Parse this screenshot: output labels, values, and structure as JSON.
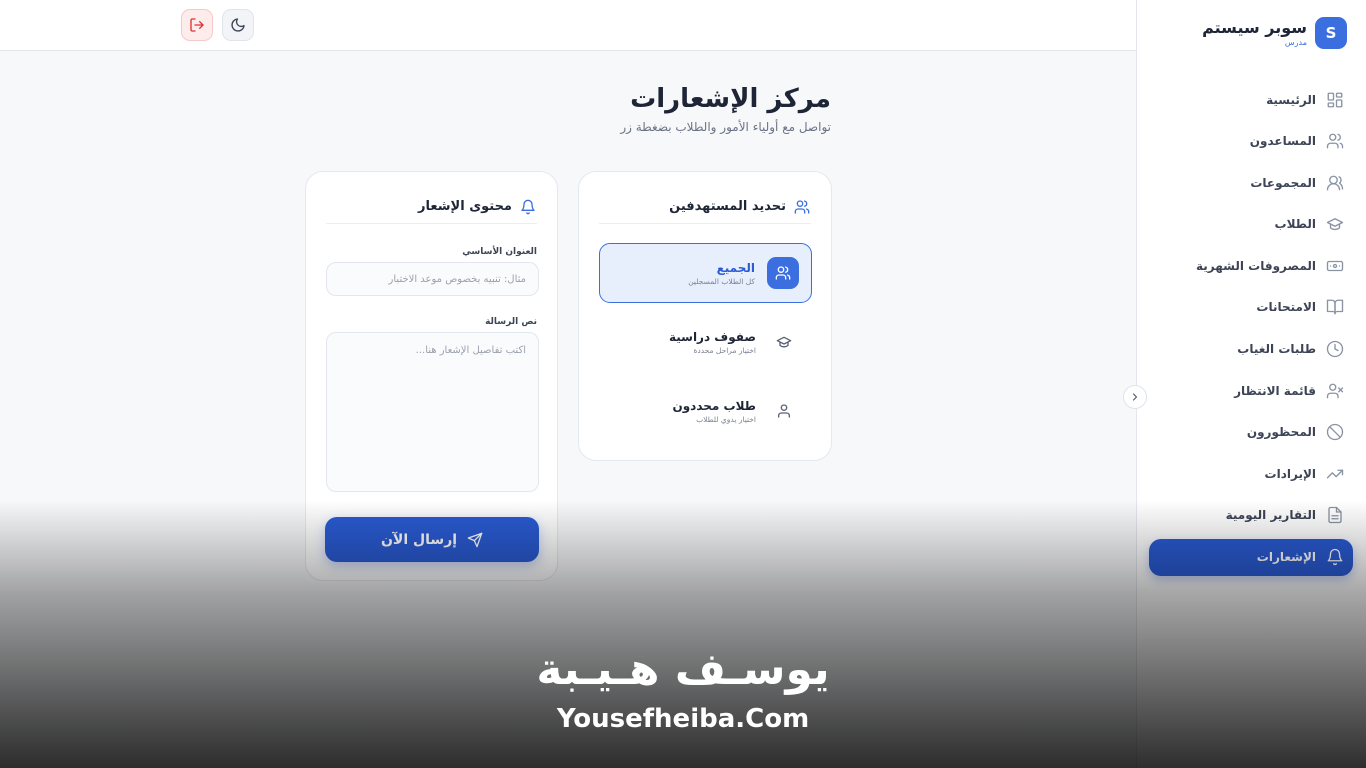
{
  "app": {
    "brand_name": "سوبر سيستم",
    "brand_role": "مدرس",
    "brand_initial": "S"
  },
  "sidebar": {
    "items": [
      {
        "label": "الرئيسية",
        "icon": "grid-icon"
      },
      {
        "label": "المساعدون",
        "icon": "users-icon"
      },
      {
        "label": "المجموعات",
        "icon": "group-icon"
      },
      {
        "label": "الطلاب",
        "icon": "graduation-cap-icon"
      },
      {
        "label": "المصروفات الشهرية",
        "icon": "banknote-icon"
      },
      {
        "label": "الامتحانات",
        "icon": "book-open-icon"
      },
      {
        "label": "طلبات الغياب",
        "icon": "clock-icon"
      },
      {
        "label": "قائمة الانتظار",
        "icon": "user-x-icon"
      },
      {
        "label": "المحظورون",
        "icon": "ban-icon"
      },
      {
        "label": "الإيرادات",
        "icon": "trending-up-icon"
      },
      {
        "label": "التقارير اليومية",
        "icon": "file-text-icon"
      },
      {
        "label": "الإشعارات",
        "icon": "bell-icon",
        "active": true
      }
    ]
  },
  "page": {
    "title": "مركز الإشعارات",
    "subtitle": "تواصل مع أولياء الأمور والطلاب بضغطة زر"
  },
  "targets": {
    "heading": "تحديد المستهدفين",
    "options": [
      {
        "title": "الجميع",
        "desc": "كل الطلاب المسجلين",
        "selected": true
      },
      {
        "title": "صفوف دراسية",
        "desc": "اختيار مراحل محددة",
        "selected": false
      },
      {
        "title": "طلاب محددون",
        "desc": "اختيار يدوي للطلاب",
        "selected": false
      }
    ]
  },
  "notification": {
    "heading": "محتوى الإشعار",
    "title_label": "العنوان الأساسي",
    "title_placeholder": "مثال: تنبيه بخصوص موعد الاختبار",
    "title_value": "",
    "message_label": "نص الرسالة",
    "message_placeholder": "اكتب تفاصيل الإشعار هنا...",
    "message_value": "",
    "send_label": "إرسال الآن"
  },
  "watermark": {
    "arabic": "يوسـف هـيـبة",
    "latin": "Yousefheiba.Com"
  },
  "colors": {
    "accent": "#2a5bd3",
    "accent_light": "#e7eefc",
    "danger": "#e0302f",
    "text": "#1e2536"
  }
}
